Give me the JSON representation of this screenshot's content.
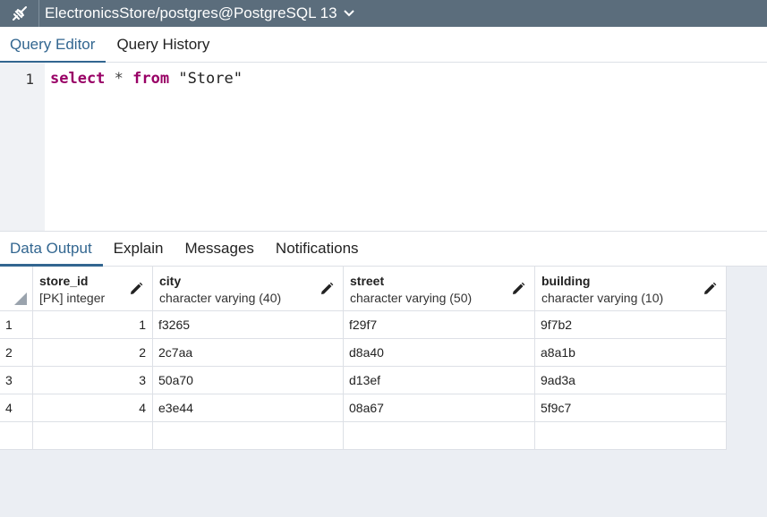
{
  "connection": {
    "title": "ElectronicsStore/postgres@PostgreSQL 13",
    "icon": "connection-icon"
  },
  "editor_tabs": [
    {
      "label": "Query Editor",
      "active": true
    },
    {
      "label": "Query History",
      "active": false
    }
  ],
  "editor": {
    "line_number": "1",
    "tokens": {
      "select": "select",
      "star": " * ",
      "from": "from",
      "table": " \"Store\""
    }
  },
  "output_tabs": [
    {
      "label": "Data Output",
      "active": true
    },
    {
      "label": "Explain",
      "active": false
    },
    {
      "label": "Messages",
      "active": false
    },
    {
      "label": "Notifications",
      "active": false
    }
  ],
  "grid": {
    "columns": [
      {
        "name": "store_id",
        "type": "[PK] integer"
      },
      {
        "name": "city",
        "type": "character varying (40)"
      },
      {
        "name": "street",
        "type": "character varying (50)"
      },
      {
        "name": "building",
        "type": "character varying (10)"
      }
    ],
    "rows": [
      {
        "num": "1",
        "store_id": "1",
        "city": "f3265",
        "street": "f29f7",
        "building": "9f7b2"
      },
      {
        "num": "2",
        "store_id": "2",
        "city": "2c7aa",
        "street": "d8a40",
        "building": "a8a1b"
      },
      {
        "num": "3",
        "store_id": "3",
        "city": "50a70",
        "street": "d13ef",
        "building": "9ad3a"
      },
      {
        "num": "4",
        "store_id": "4",
        "city": "e3e44",
        "street": "08a67",
        "building": "5f9c7"
      }
    ]
  },
  "colors": {
    "connection_bar": "#5b6d7c",
    "active_tab": "#326690",
    "keyword": "#990066"
  }
}
